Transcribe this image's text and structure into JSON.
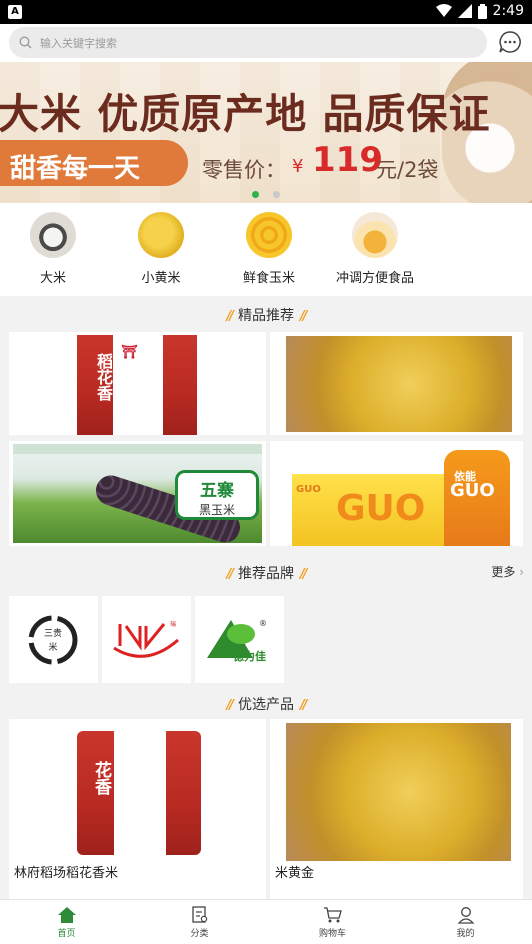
{
  "status_bar": {
    "app_badge": "A",
    "time": "2:49"
  },
  "search": {
    "placeholder": "输入关键字搜索",
    "message_icon": "chat-bubble-icon"
  },
  "banner": {
    "headline": "大米 优质原产地 品质保证",
    "slogan": "甜香每一天",
    "price_label": "零售价：",
    "price_currency": "¥",
    "price_value": "119",
    "price_unit": "元/2袋",
    "slide_count": 2,
    "active_slide": 1
  },
  "categories": [
    {
      "label": "大米",
      "icon": "rice-bowl-icon"
    },
    {
      "label": "小黄米",
      "icon": "millet-icon"
    },
    {
      "label": "鲜食玉米",
      "icon": "corn-icon"
    },
    {
      "label": "冲调方便食品",
      "icon": "drink-cup-icon"
    }
  ],
  "featured": {
    "title": "精品推荐",
    "images": [
      {
        "subject": "rice-bag",
        "text": "林府稻場 稻花香"
      },
      {
        "subject": "millet-in-hand"
      },
      {
        "subject": "black-corn",
        "text_main": "五寨",
        "text_sub": "黑玉米"
      },
      {
        "subject": "guo-juice",
        "text_main": "GUO",
        "bottle_brand": "依能"
      }
    ]
  },
  "brands": {
    "title": "推荐品牌",
    "more_label": "更多",
    "items": [
      {
        "logo": "seal-logo",
        "text": "三贵米"
      },
      {
        "logo": "red-wave-logo"
      },
      {
        "logo": "leaf-logo",
        "text": "德力佳"
      }
    ]
  },
  "selected": {
    "title": "优选产品",
    "products": [
      {
        "name": "林府稻场稻花香米",
        "image": "rice-bag"
      },
      {
        "name": "米黄金",
        "image": "millet-in-hand"
      }
    ]
  },
  "tabbar": {
    "tabs": [
      {
        "label": "首页",
        "icon": "home-icon",
        "active": true
      },
      {
        "label": "分类",
        "icon": "category-list-icon",
        "active": false
      },
      {
        "label": "购物车",
        "icon": "cart-icon",
        "active": false
      },
      {
        "label": "我的",
        "icon": "user-icon",
        "active": false
      }
    ]
  },
  "colors": {
    "accent_green": "#2e8b3a",
    "price_red": "#d92a2a",
    "title_slash": "#f0a020"
  }
}
